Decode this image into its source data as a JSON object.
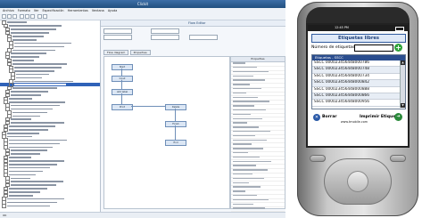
{
  "desktop": {
    "window_title": "Clickit",
    "menu": [
      "Archivo",
      "Formato",
      "Ver",
      "Especificación",
      "Herramientas",
      "Ventana",
      "Ayuda"
    ],
    "content_title": "Flow Editor",
    "tabs": [
      "Flow diagram",
      "Properties"
    ],
    "status": "OK",
    "properties_header": "Properties",
    "diagram_nodes": [
      "Start",
      "Input",
      "Add label",
      "Print",
      "Delete",
      "Finish",
      "End"
    ]
  },
  "pda": {
    "status_time": "12:45 PM",
    "app_title": "Etiquetas libres",
    "numero_label": "Número de etiquetas:",
    "numero_value": "",
    "list_header": "Etiquetas - SSCC",
    "list_items": [
      "SSCC 000023456448000786",
      "SSCC 000023456448000748",
      "SSCC 000023456448000734",
      "SSCC 000023456448000842",
      "SSCC 000023456448000888",
      "SSCC 000023456448000866",
      "SSCC 000023456448000956"
    ],
    "borrar_label": "Borrar",
    "imprimir_label": "Imprimir Etiqueta",
    "web": "www.tmobile.com",
    "colors": {
      "accent": "#2a4d8e",
      "add_button": "#2fa23a"
    }
  }
}
